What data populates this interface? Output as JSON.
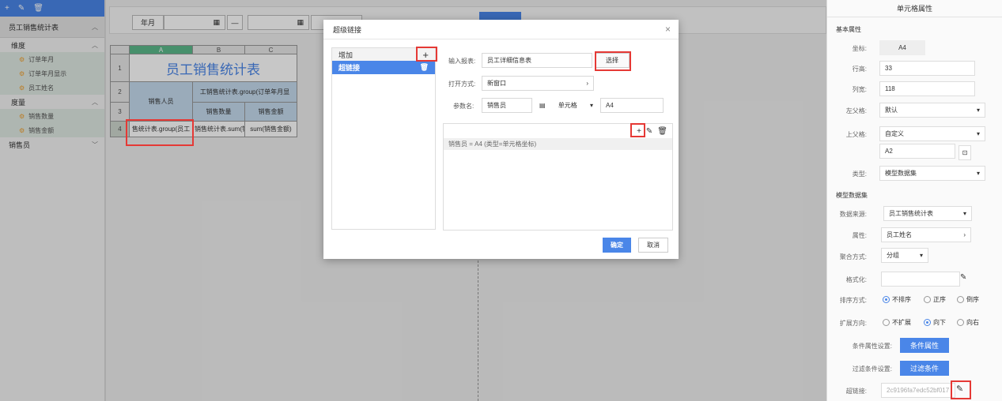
{
  "left": {
    "ds_name": "员工销售统计表",
    "dim_label": "维度",
    "dim_fields": [
      "订单年月",
      "订单年月显示",
      "员工姓名"
    ],
    "mea_label": "度量",
    "mea_fields": [
      "销售数量",
      "销售金额"
    ],
    "extra_group": "销售员"
  },
  "filter": {
    "label1": "年月",
    "dash": "—"
  },
  "grid": {
    "cols": [
      "A",
      "B",
      "C"
    ],
    "rows": [
      "1",
      "2",
      "3",
      "4"
    ],
    "title": "员工销售统计表",
    "hdr_person": "销售人员",
    "hdr_group": "工销售统计表.group(订单年月显",
    "hdr_qty": "销售数量",
    "hdr_amt": "销售金额",
    "c_a4": "售统计表.group(员工",
    "c_b4": "销售统计表.sum(销售",
    "c_c4": "sum(销售金额)"
  },
  "dialog": {
    "title": "超级链接",
    "close": "×",
    "add_label": "增加",
    "add_icon": "+",
    "item": "超链接",
    "report_label": "输入报表:",
    "report_value": "员工详细信息表",
    "choose_btn": "选择",
    "open_label": "打开方式:",
    "open_value": "新窗口",
    "param_label": "参数名:",
    "param_name": "销售员",
    "param_type": "单元格",
    "param_value": "A4",
    "cond_row": "销售员 = A4 (类型=单元格坐标)",
    "ok": "确定",
    "cancel": "取消"
  },
  "right": {
    "title": "单元格属性",
    "basic": "基本属性",
    "coord_label": "坐标:",
    "coord": "A4",
    "row_h_label": "行高:",
    "row_h": "33",
    "col_w_label": "列宽:",
    "col_w": "118",
    "left_parent_label": "左父格:",
    "left_parent": "默认",
    "top_parent_label": "上父格:",
    "top_parent": "自定义",
    "top_parent_cell": "A2",
    "type_label": "类型:",
    "type": "模型数据集",
    "model_sec": "模型数据集",
    "src_label": "数据来源:",
    "src": "员工销售统计表",
    "attr_label": "属性:",
    "attr": "员工姓名",
    "agg_label": "聚合方式:",
    "agg": "分组",
    "fmt_label": "格式化:",
    "sort_label": "排序方式:",
    "sort_opts": [
      "不排序",
      "正序",
      "倒序"
    ],
    "expand_label": "扩展方向:",
    "expand_opts": [
      "不扩展",
      "向下",
      "向右"
    ],
    "cond_attr_label": "条件属性设置:",
    "cond_attr_btn": "条件属性",
    "filter_label": "过滤条件设置:",
    "filter_btn": "过滤条件",
    "link_label": "超链接:",
    "link_value": "2c9196fa7edc52bf017"
  }
}
